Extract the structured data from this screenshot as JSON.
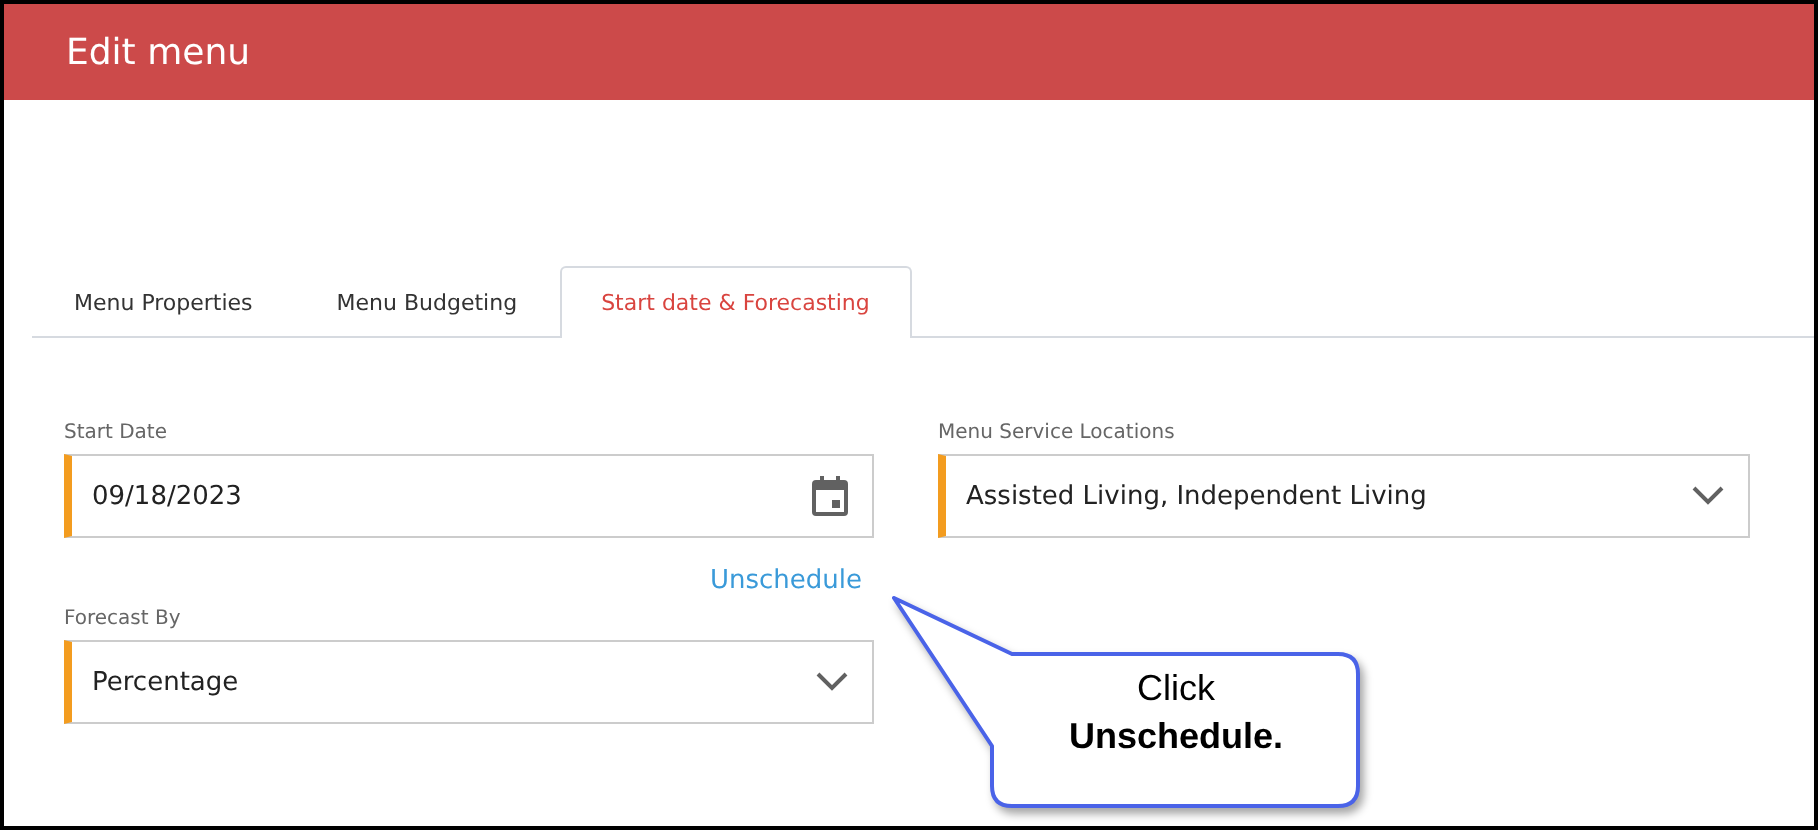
{
  "header": {
    "title": "Edit menu"
  },
  "tabs": [
    {
      "label": "Menu Properties",
      "selected": false
    },
    {
      "label": "Menu Budgeting",
      "selected": false
    },
    {
      "label": "Start date & Forecasting",
      "selected": true
    }
  ],
  "start_date": {
    "label": "Start Date",
    "value": "09/18/2023"
  },
  "service_locations": {
    "label": "Menu Service Locations",
    "value": "Assisted Living, Independent Living"
  },
  "unschedule_link": "Unschedule",
  "forecast_by": {
    "label": "Forecast By",
    "value": "Percentage"
  },
  "callout": {
    "text": "Click\n**Unschedule.**"
  }
}
